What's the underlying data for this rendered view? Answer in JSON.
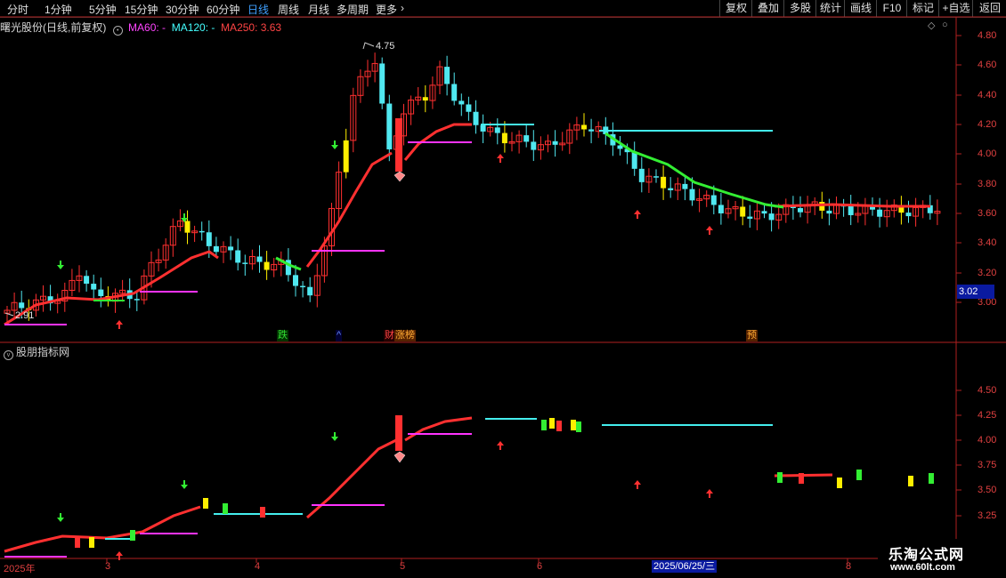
{
  "toolbar": {
    "tabs": [
      "分时",
      "1分钟",
      "5分钟",
      "15分钟",
      "30分钟",
      "60分钟",
      "日线",
      "周线",
      "月线",
      "多周期",
      "更多"
    ],
    "active": "日线",
    "right_buttons": [
      "复权",
      "叠加",
      "多股",
      "统计",
      "画线",
      "F10",
      "标记",
      "+自选",
      "返回"
    ]
  },
  "main_header": {
    "stock": "曙光股份(日线,前复权)",
    "ma60": "MA60: -",
    "ma120": "MA120: -",
    "ma250": "MA250: 3.63"
  },
  "price_axis": [
    "4.80",
    "4.60",
    "4.40",
    "4.20",
    "4.00",
    "3.80",
    "3.60",
    "3.40",
    "3.20",
    "3.00"
  ],
  "current_price": "3.02",
  "annotations": {
    "high": "4.75",
    "low": "2.91"
  },
  "tags": [
    {
      "text": "跌",
      "color": "#33dd33",
      "bg": "#003300"
    },
    {
      "text": "^",
      "color": "#6688ff",
      "bg": "#000033"
    },
    {
      "text": "财",
      "color": "#ff4444",
      "bg": "#220000"
    },
    {
      "text": "涨榜",
      "color": "#ffaa33",
      "bg": "#552200"
    },
    {
      "text": "预",
      "color": "#ffaa33",
      "bg": "#552200"
    }
  ],
  "sub_panel": {
    "title": "股朋指标网",
    "axis": [
      "4.50",
      "4.25",
      "4.00",
      "3.75",
      "3.50",
      "3.25"
    ]
  },
  "date_axis": {
    "labels": [
      "2025年",
      "3",
      "4",
      "5",
      "6",
      "8"
    ],
    "highlight": "2025/06/25/三"
  },
  "watermark": {
    "line1": "乐淘公式网",
    "line2": "www.60lt.com"
  },
  "colors": {
    "up": "#ff3030",
    "down": "#50e8f0",
    "yellow": "#ffee00",
    "green_line": "#33ee33",
    "magenta": "#ff33ff",
    "cyan": "#44eeee"
  }
}
